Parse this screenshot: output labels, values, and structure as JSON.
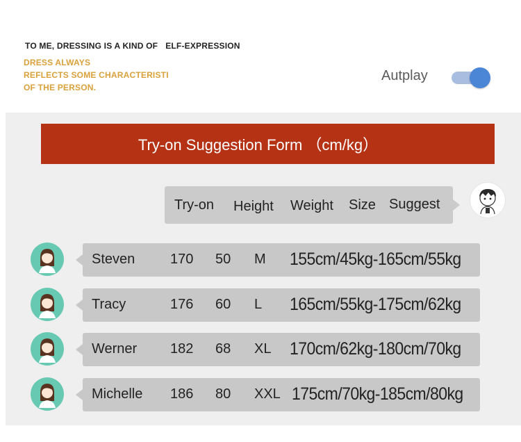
{
  "header": {
    "tagline_part1": "TO ME, DRESSING IS A KIND OF",
    "tagline_part2": "ELF-EXPRESSION",
    "subtext": [
      "DRESS ALWAYS",
      "REFLECTS SOME CHARACTERISTI",
      "OF THE PERSON."
    ],
    "autoplay_label": "Autplay",
    "autoplay_on": true
  },
  "form": {
    "title": "Try-on Suggestion Form  （cm/kg）",
    "columns": [
      "Try-on",
      "Height",
      "Weight",
      "Size",
      "Suggest"
    ],
    "rows": [
      {
        "name": "Steven",
        "height": "170",
        "weight": "50",
        "size": "M",
        "suggest": "155cm/45kg-165cm/55kg"
      },
      {
        "name": "Tracy",
        "height": "176",
        "weight": "60",
        "size": "L",
        "suggest": "165cm/55kg-175cm/62kg"
      },
      {
        "name": "Werner",
        "height": "182",
        "weight": "68",
        "size": "XL",
        "suggest": "170cm/62kg-180cm/70kg"
      },
      {
        "name": "Michelle",
        "height": "186",
        "weight": "80",
        "size": "XXL",
        "suggest": "175cm/70kg-185cm/80kg"
      }
    ]
  },
  "colors": {
    "banner": "#b53214",
    "tagline_gold": "#d9a13a",
    "toggle_knob": "#4b86d6",
    "avatar_bg": "#68c9b3"
  }
}
